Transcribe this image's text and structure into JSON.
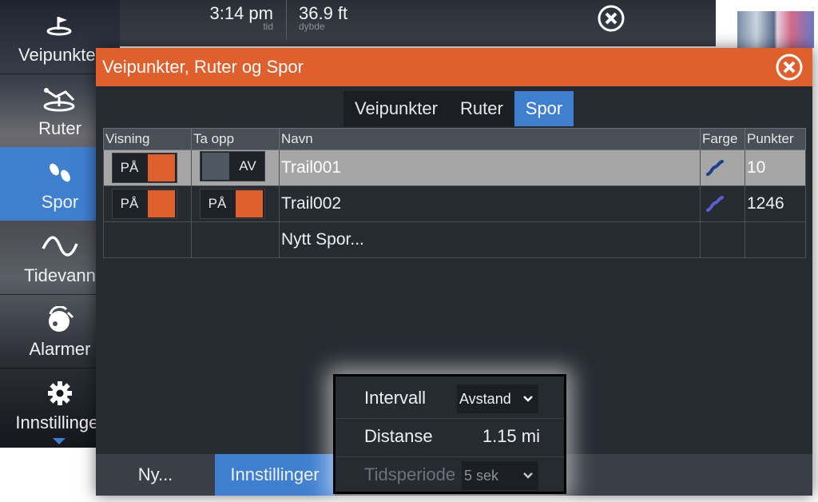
{
  "topbar": {
    "time": {
      "value": "3:14 pm",
      "caption": "tid"
    },
    "depth": {
      "value": "36.9 ft",
      "caption": "dybde"
    }
  },
  "sidebar": {
    "items": [
      {
        "label": "Veipunkter",
        "icon": "waypoint-flag-icon"
      },
      {
        "label": "Ruter",
        "icon": "route-icon"
      },
      {
        "label": "Spor",
        "icon": "footsteps-icon",
        "active": true
      },
      {
        "label": "Tidevann",
        "icon": "tide-wave-icon"
      },
      {
        "label": "Alarmer",
        "icon": "alarm-bell-icon"
      },
      {
        "label": "Innstillinger",
        "icon": "gear-icon"
      }
    ]
  },
  "dialog": {
    "title": "Veipunkter, Ruter og Spor",
    "tabs": [
      {
        "label": "Veipunkter"
      },
      {
        "label": "Ruter"
      },
      {
        "label": "Spor",
        "active": true
      }
    ],
    "columns": {
      "visning": "Visning",
      "taopp": "Ta opp",
      "navn": "Navn",
      "farge": "Farge",
      "punkter": "Punkter"
    },
    "rows": [
      {
        "visning": "PÅ",
        "taopp": "AV",
        "navn": "Trail001",
        "farge": "#1c3f8a",
        "punkter": "10",
        "selected": true
      },
      {
        "visning": "PÅ",
        "taopp": "PÅ",
        "navn": "Trail002",
        "farge": "#5b5fd0",
        "punkter": "1246"
      },
      {
        "navn": "Nytt Spor..."
      }
    ],
    "footer": {
      "new_label": "Ny...",
      "settings_label": "Innstillinger"
    }
  },
  "settings_popup": {
    "interval_label": "Intervall",
    "interval_value": "Avstand",
    "distance_label": "Distanse",
    "distance_value": "1.15 mi",
    "period_label": "Tidsperiode",
    "period_value": "5 sek"
  },
  "colors": {
    "accent": "#e0602d",
    "selected": "#3f7fd0"
  }
}
